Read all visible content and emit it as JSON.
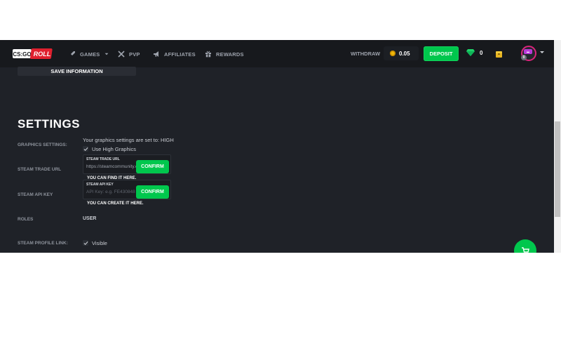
{
  "brand": {
    "logo_text_left": "CS:GO",
    "logo_text_right": "ROLL"
  },
  "nav": {
    "items": [
      {
        "label": "GAMES",
        "icon": "rocket-icon"
      },
      {
        "label": "PVP",
        "icon": "crossed-swords-icon"
      },
      {
        "label": "AFFILIATES",
        "icon": "megaphone-icon"
      },
      {
        "label": "REWARDS",
        "icon": "gift-icon"
      }
    ],
    "withdraw": "WITHDRAW",
    "balance": "0.05",
    "deposit": "DEPOSIT",
    "gems": "0",
    "avatar_badge": "0"
  },
  "content": {
    "save_button": "SAVE INFORMATION",
    "section_title": "SETTINGS",
    "graphics": {
      "label": "GRAPHICS SETTINGS:",
      "status": "Your graphics settings are set to: HIGH",
      "checkbox_label": "Use High Graphics",
      "checked": true
    },
    "trade_url": {
      "label": "STEAM TRADE URL",
      "field_label": "STEAM TRADE URL",
      "value": "https://steamcommunity.com/tradeoffer/new/",
      "confirm": "CONFIRM",
      "hint": "YOU CAN FIND IT HERE."
    },
    "api_key": {
      "label": "STEAM API KEY",
      "field_label": "STEAM API KEY",
      "placeholder": "API Key: e.g. FE430848",
      "confirm": "CONFIRM",
      "hint": "YOU CAN CREATE IT HERE."
    },
    "roles": {
      "label": "ROLES",
      "value": "USER"
    },
    "profile_link": {
      "label": "STEAM PROFILE LINK:",
      "checkbox_label": "Visible",
      "checked": true
    }
  },
  "colors": {
    "background": "#1f2228",
    "topbar": "#17191d",
    "accent_green": "#00c74d",
    "coin": "#f0b90b"
  }
}
